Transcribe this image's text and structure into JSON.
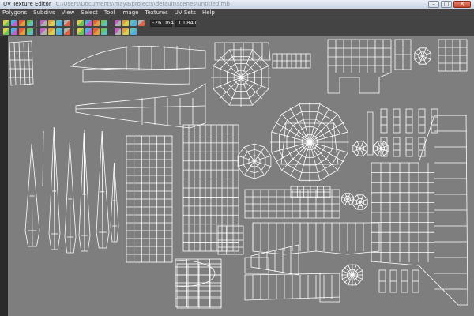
{
  "window": {
    "title": "UV Texture Editor",
    "subtitle_faded": "C:\\Users\\Documents\\maya\\projects\\default\\scenes\\untitled.mb",
    "controls": {
      "minimize": "–",
      "maximize": "□",
      "close": "✕"
    }
  },
  "menu": {
    "items": [
      "Polygons",
      "Subdivs",
      "View",
      "Select",
      "Tool",
      "Image",
      "Textures",
      "UV Sets",
      "Help"
    ]
  },
  "toolbar": {
    "u_value": "-26.064",
    "v_value": "10.841",
    "icons_row1": [
      "uv-select-icon",
      "uv-move-icon",
      "uv-scale-icon",
      "uv-rotate-icon",
      "flip-u-icon",
      "flip-v-icon",
      "cut-uv-icon",
      "sew-uv-icon",
      "unfold-icon",
      "layout-icon",
      "grid-toggle-icon",
      "snap-icon",
      "image-toggle-icon",
      "dim-image-icon",
      "shaded-uv-icon",
      "texture-borders-icon"
    ],
    "icons_row2": [
      "rotate-ccw-icon",
      "rotate-cw-icon",
      "align-min-u-icon",
      "align-max-u-icon",
      "align-min-v-icon",
      "align-max-v-icon",
      "relax-icon",
      "straighten-icon",
      "select-shell-icon",
      "select-border-icon",
      "isolate-icon",
      "frame-all-icon",
      "frame-selected-icon",
      "copy-uv-icon",
      "paste-uv-icon"
    ],
    "icon_colors": [
      "#d8d050",
      "#4fb0e0",
      "#e06040",
      "#70c060",
      "#c060c0",
      "#e0a040",
      "#60c0c0",
      "#b0b0b0"
    ]
  },
  "viewport": {
    "background": "#7e7e7e",
    "wire_color": "#ffffff"
  }
}
